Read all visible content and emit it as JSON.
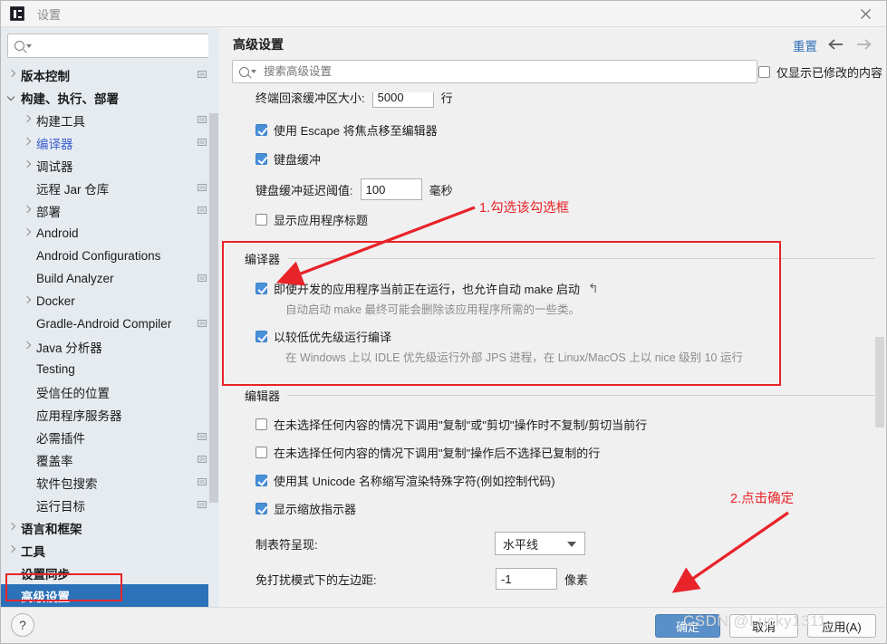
{
  "window": {
    "title": "设置",
    "app_icon": "intellij-idea-icon",
    "close_icon": "close-icon"
  },
  "sidebar": {
    "search": {
      "placeholder": "",
      "value": "",
      "icon": "search-icon"
    },
    "items": [
      {
        "label": "版本控制",
        "arrow": "collapsed",
        "indent": 0,
        "bold": true,
        "badge": true
      },
      {
        "label": "构建、执行、部署",
        "arrow": "expanded",
        "indent": 0,
        "bold": true,
        "badge": false
      },
      {
        "label": "构建工具",
        "arrow": "collapsed",
        "indent": 1,
        "bold": false,
        "badge": true
      },
      {
        "label": "编译器",
        "arrow": "collapsed",
        "indent": 1,
        "bold": false,
        "badge": true,
        "blue": true
      },
      {
        "label": "调试器",
        "arrow": "collapsed",
        "indent": 1,
        "bold": false,
        "badge": false
      },
      {
        "label": "远程 Jar 仓库",
        "arrow": "none",
        "indent": 1,
        "bold": false,
        "badge": true
      },
      {
        "label": "部署",
        "arrow": "collapsed",
        "indent": 1,
        "bold": false,
        "badge": true
      },
      {
        "label": "Android",
        "arrow": "collapsed",
        "indent": 1,
        "bold": false,
        "badge": false
      },
      {
        "label": "Android Configurations",
        "arrow": "none",
        "indent": 1,
        "bold": false,
        "badge": false
      },
      {
        "label": "Build Analyzer",
        "arrow": "none",
        "indent": 1,
        "bold": false,
        "badge": true
      },
      {
        "label": "Docker",
        "arrow": "collapsed",
        "indent": 1,
        "bold": false,
        "badge": false
      },
      {
        "label": "Gradle-Android Compiler",
        "arrow": "none",
        "indent": 1,
        "bold": false,
        "badge": true
      },
      {
        "label": "Java 分析器",
        "arrow": "collapsed",
        "indent": 1,
        "bold": false,
        "badge": false
      },
      {
        "label": "Testing",
        "arrow": "none",
        "indent": 1,
        "bold": false,
        "badge": false
      },
      {
        "label": "受信任的位置",
        "arrow": "none",
        "indent": 1,
        "bold": false,
        "badge": false
      },
      {
        "label": "应用程序服务器",
        "arrow": "none",
        "indent": 1,
        "bold": false,
        "badge": false
      },
      {
        "label": "必需插件",
        "arrow": "none",
        "indent": 1,
        "bold": false,
        "badge": true
      },
      {
        "label": "覆盖率",
        "arrow": "none",
        "indent": 1,
        "bold": false,
        "badge": true
      },
      {
        "label": "软件包搜索",
        "arrow": "none",
        "indent": 1,
        "bold": false,
        "badge": true
      },
      {
        "label": "运行目标",
        "arrow": "none",
        "indent": 1,
        "bold": false,
        "badge": true
      },
      {
        "label": "语言和框架",
        "arrow": "collapsed",
        "indent": 0,
        "bold": true,
        "badge": false
      },
      {
        "label": "工具",
        "arrow": "collapsed",
        "indent": 0,
        "bold": true,
        "badge": false
      },
      {
        "label": "设置同步",
        "arrow": "none",
        "indent": 0,
        "bold": true,
        "badge": false
      },
      {
        "label": "高级设置",
        "arrow": "none",
        "indent": 0,
        "bold": true,
        "badge": false,
        "selected": true
      }
    ]
  },
  "main": {
    "page_title": "高级设置",
    "reset_label": "重置",
    "back_icon": "arrow-left-icon",
    "forward_icon": "arrow-right-icon",
    "search": {
      "placeholder": "搜索高级设置",
      "value": "",
      "icon": "search-icon"
    },
    "modified_only": {
      "label": "仅显示已修改的内容",
      "checked": false
    },
    "terminal": {
      "buffer_label": "终端回滚缓冲区大小:",
      "buffer_value": "5000",
      "buffer_unit": "行"
    },
    "top_options": [
      {
        "label": "使用 Escape 将焦点移至编辑器",
        "checked": true
      },
      {
        "label": "键盘缓冲",
        "checked": true
      }
    ],
    "keyboard_delay": {
      "label": "键盘缓冲延迟阈值:",
      "value": "100",
      "unit": "毫秒"
    },
    "show_app_title": {
      "label": "显示应用程序标题",
      "checked": false
    },
    "compiler_group": {
      "title": "编译器",
      "options": [
        {
          "label": "即使开发的应用程序当前正在运行，也允许自动 make 启动",
          "checked": true,
          "revert_icon": "revert-icon",
          "description": "自动启动 make 最终可能会删除该应用程序所需的一些类。"
        },
        {
          "label": "以较低优先级运行编译",
          "checked": true,
          "revert_icon": "",
          "description": "在 Windows 上以 IDLE 优先级运行外部 JPS 进程，在 Linux/MacOS 上以 nice 级别 10 运行"
        }
      ]
    },
    "editor_group": {
      "title": "编辑器",
      "options": [
        {
          "label": "在未选择任何内容的情况下调用\"复制\"或\"剪切\"操作时不复制/剪切当前行",
          "checked": false
        },
        {
          "label": "在未选择任何内容的情况下调用\"复制\"操作后不选择已复制的行",
          "checked": false
        },
        {
          "label": "使用其 Unicode 名称缩写渲染特殊字符(例如控制代码)",
          "checked": true
        },
        {
          "label": "显示缩放指示器",
          "checked": true
        }
      ],
      "tab_render": {
        "label": "制表符呈现:",
        "value": "水平线",
        "caret_icon": "chevron-down-icon"
      },
      "zen_margin": {
        "label": "免打扰模式下的左边距:",
        "value": "-1",
        "unit": "像素"
      }
    }
  },
  "bottom": {
    "help_icon": "help-icon",
    "ok_label": "确定",
    "cancel_label": "取消",
    "apply_label": "应用(A)"
  },
  "annotations": {
    "step1": "1.勾选该勾选框",
    "step2": "2.点击确定",
    "accent": "#e8232a"
  },
  "watermark": "CSDN @Lucky1311"
}
